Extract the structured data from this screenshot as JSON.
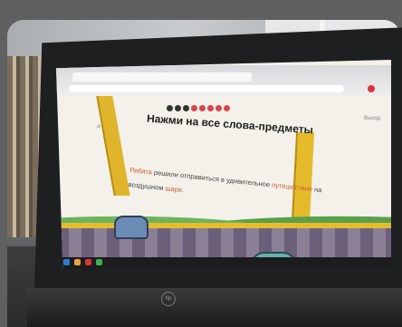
{
  "task": {
    "title": "Нажми на все слова-предметы",
    "exit_label": "Выход"
  },
  "sentence": [
    {
      "text": "Ребята",
      "noun": true
    },
    {
      "text": "решили",
      "noun": false
    },
    {
      "text": "отправиться",
      "noun": false
    },
    {
      "text": "в",
      "noun": false
    },
    {
      "text": "удивительное",
      "noun": false
    },
    {
      "text": "путешествие",
      "noun": true
    },
    {
      "text": "на",
      "noun": false
    },
    {
      "text": "воздушном",
      "noun": false
    },
    {
      "text": "шаре.",
      "noun": true
    }
  ],
  "progress": {
    "total": 8,
    "done": 3
  },
  "icons": [
    "close-icon",
    "profile-icon",
    "menu-icon",
    "gem-icon"
  ],
  "colors": {
    "accent": "#e0b52b",
    "noun_highlight": "#d35b2e",
    "progress_done": "#333333",
    "progress_todo": "#d8454b"
  }
}
